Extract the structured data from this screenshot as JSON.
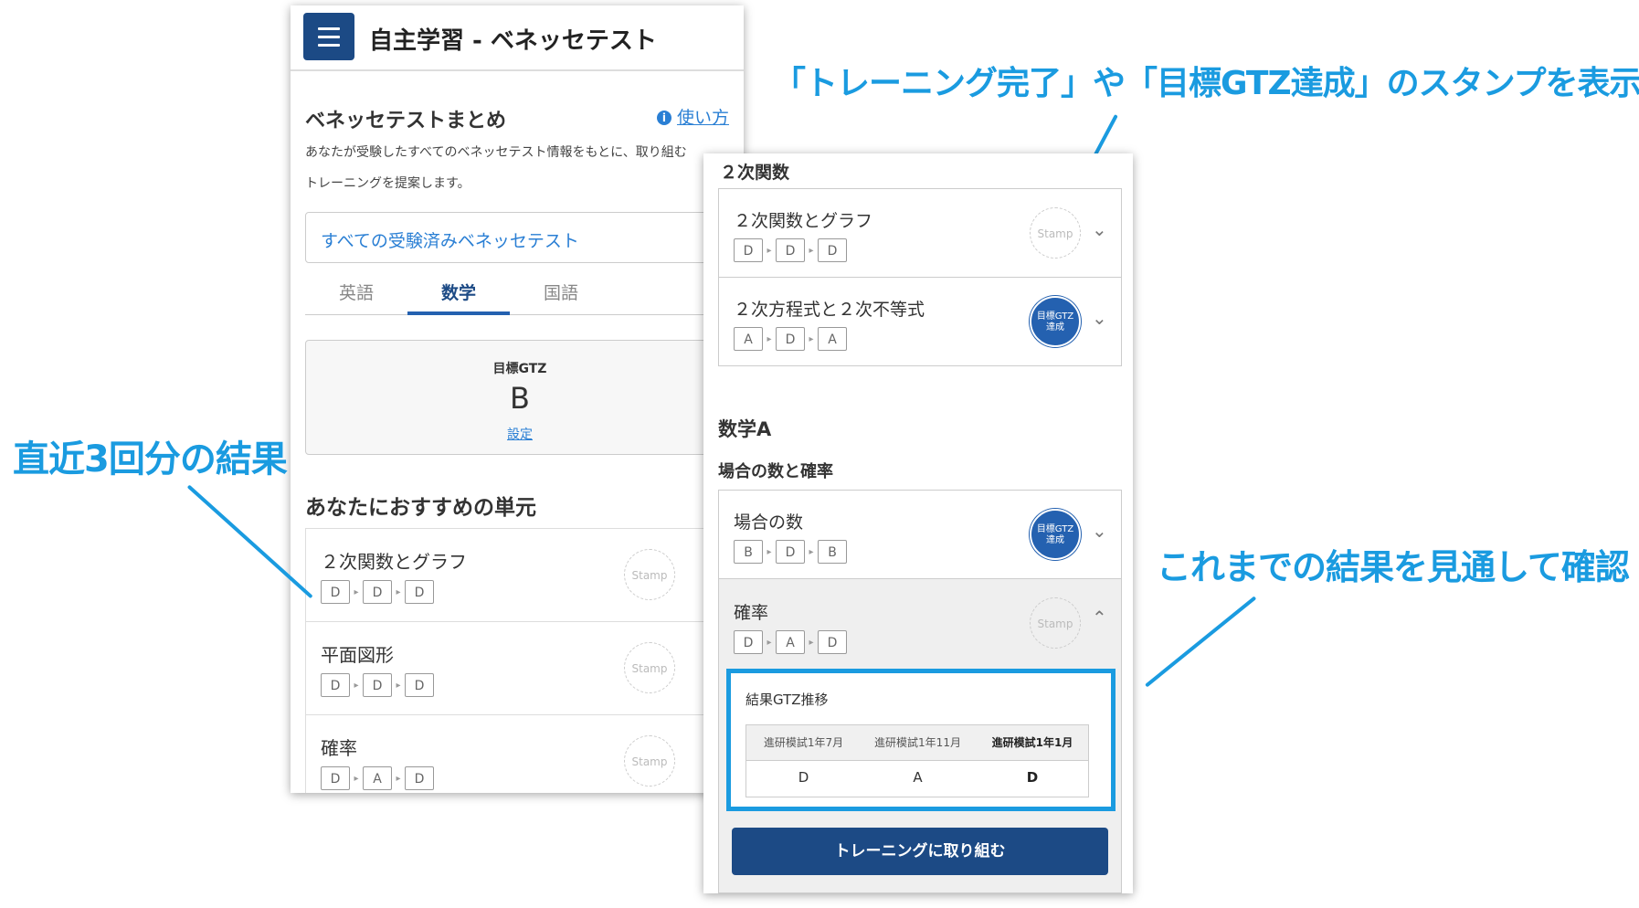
{
  "callouts": {
    "stamp": "「トレーニング完了」や「目標GTZ達成」のスタンプを表示",
    "recent": "直近3回分の結果",
    "overview": "これまでの結果を見通して確認"
  },
  "screen1": {
    "app_title": "自主学習 - ベネッセテスト",
    "section_title": "ベネッセテストまとめ",
    "help_link": "使い方",
    "description": "あなたが受験したすべてのベネッセテスト情報をもとに、取り組むトレーニングを提案します。",
    "description_line1": "あなたが受験したすべてのベネッセテスト情報をもとに、取り組む",
    "description_line2": "トレーニングを提案します。",
    "select_value": "すべての受験済みベネッセテスト",
    "tabs": [
      {
        "label": "英語",
        "active": false
      },
      {
        "label": "数学",
        "active": true
      },
      {
        "label": "国語",
        "active": false
      }
    ],
    "goal": {
      "label": "目標GTZ",
      "value": "B",
      "setting_link": "設定"
    },
    "recommend_title": "あなたにおすすめの単元",
    "units": [
      {
        "name": "２次関数とグラフ",
        "grades": [
          "D",
          "D",
          "D"
        ],
        "stamp": "Stamp"
      },
      {
        "name": "平面図形",
        "grades": [
          "D",
          "D",
          "D"
        ],
        "stamp": "Stamp"
      },
      {
        "name": "確率",
        "grades": [
          "D",
          "A",
          "D"
        ],
        "stamp": "Stamp"
      }
    ]
  },
  "screen2": {
    "category_quad": "２次関数",
    "quad_units": [
      {
        "name": "２次関数とグラフ",
        "grades": [
          "D",
          "D",
          "D"
        ],
        "stamp": "Stamp",
        "achieved": false
      },
      {
        "name": "２次方程式と２次不等式",
        "grades": [
          "A",
          "D",
          "A"
        ],
        "stamp_line1": "目標GTZ",
        "stamp_line2": "達成",
        "achieved": true
      }
    ],
    "subject_a": "数学A",
    "category_prob": "場合の数と確率",
    "prob_units": [
      {
        "name": "場合の数",
        "grades": [
          "B",
          "D",
          "B"
        ],
        "stamp_line1": "目標GTZ",
        "stamp_line2": "達成",
        "achieved": true
      },
      {
        "name": "確率",
        "grades": [
          "D",
          "A",
          "D"
        ],
        "stamp": "Stamp",
        "achieved": false
      }
    ],
    "history": {
      "title": "結果GTZ推移",
      "headers": [
        "進研模試1年7月",
        "進研模試1年11月",
        "進研模試1年1月"
      ],
      "values": [
        "D",
        "A",
        "D"
      ]
    },
    "train_button": "トレーニングに取り組む"
  },
  "colors": {
    "accent": "#1a9be0",
    "brand": "#1c4a85",
    "link": "#2a7fd4",
    "stamp_achieved": "#2461b0"
  }
}
